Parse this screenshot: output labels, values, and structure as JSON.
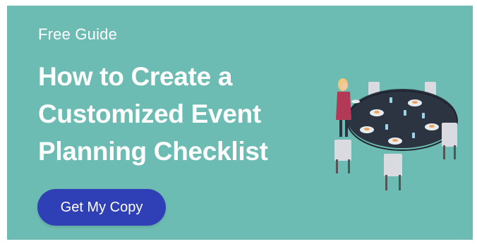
{
  "banner": {
    "eyebrow": "Free Guide",
    "headline_lines": [
      "How to Create a",
      "Customized Event",
      "Planning Checklist"
    ],
    "cta_label": "Get My Copy"
  },
  "illustration": {
    "icon": "event-table-illustration-icon"
  },
  "colors": {
    "background": "#6dbcb3",
    "button": "#2f3fb5",
    "text": "#ffffff",
    "table": "#2c3441",
    "chair": "#d9dbe0",
    "host_dress": "#b23a57"
  }
}
